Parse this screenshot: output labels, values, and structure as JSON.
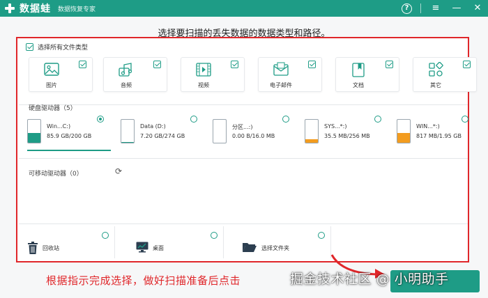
{
  "app": {
    "name": "数据蛙",
    "subtitle": "数据恢复专家"
  },
  "window_controls": {
    "help": "?",
    "menu": "≡",
    "minimize": "—",
    "close": "✕"
  },
  "headline": "选择要扫描的丢失数据的数据类型和路径。",
  "select_all": {
    "label": "选择所有文件类型",
    "checked": true
  },
  "file_types": [
    {
      "label": "图片",
      "icon": "image-icon",
      "checked": true
    },
    {
      "label": "音频",
      "icon": "music-icon",
      "checked": true
    },
    {
      "label": "视频",
      "icon": "video-icon",
      "checked": true
    },
    {
      "label": "电子邮件",
      "icon": "email-icon",
      "checked": true
    },
    {
      "label": "文档",
      "icon": "document-icon",
      "checked": true
    },
    {
      "label": "其它",
      "icon": "other-icon",
      "checked": true
    }
  ],
  "hard_drives": {
    "title": "硬盘驱动器（5）",
    "items": [
      {
        "name": "Win...C:)",
        "size": "85.9 GB/200 GB",
        "used_fraction": 0.43,
        "color": "#1e9c86",
        "selected": true
      },
      {
        "name": "Data (D:)",
        "size": "7.20 GB/274 GB",
        "used_fraction": 0.03,
        "color": "#1e9c86",
        "selected": false
      },
      {
        "name": "分区...:)",
        "size": "0.00  B/16.0 MB",
        "used_fraction": 0.0,
        "color": "#f39c1f",
        "selected": false
      },
      {
        "name": "SYS...*:)",
        "size": "35.5 MB/256 MB",
        "used_fraction": 0.14,
        "color": "#f39c1f",
        "selected": false
      },
      {
        "name": "WIN...*:)",
        "size": "817 MB/1.95 GB",
        "used_fraction": 0.42,
        "color": "#f39c1f",
        "selected": false
      }
    ]
  },
  "removable_drives": {
    "title": "可移动驱动器（0）"
  },
  "locations": [
    {
      "label": "回收站",
      "icon": "trash-icon"
    },
    {
      "label": "桌面",
      "icon": "desktop-icon"
    },
    {
      "label": "选择文件夹",
      "icon": "folder-icon"
    }
  ],
  "annotation": "根据指示完成选择，做好扫描准备后点击",
  "watermark": "掘金技术社区 @ 小明助手",
  "colors": {
    "brand": "#1e9c86",
    "annotation_red": "#e0262a",
    "warning_orange": "#f39c1f"
  }
}
